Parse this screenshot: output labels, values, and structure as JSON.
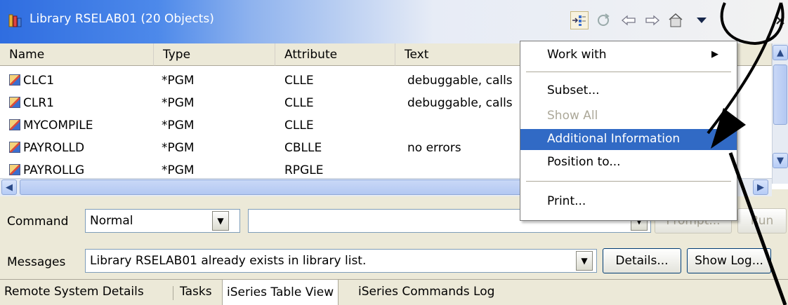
{
  "view": {
    "title": "Library RSELAB01 (20 Objects)",
    "toolbar_icons": [
      "link-with-editor-icon",
      "refresh-icon",
      "back-arrow-icon",
      "forward-arrow-icon",
      "home-icon",
      "view-menu-icon",
      "close-icon"
    ]
  },
  "table": {
    "columns": [
      "Name",
      "Type",
      "Attribute",
      "Text"
    ],
    "rows": [
      {
        "name": "CLC1",
        "type": "*PGM",
        "attribute": "CLLE",
        "text": "debuggable, calls"
      },
      {
        "name": "CLR1",
        "type": "*PGM",
        "attribute": "CLLE",
        "text": "debuggable, calls"
      },
      {
        "name": "MYCOMPILE",
        "type": "*PGM",
        "attribute": "CLLE",
        "text": ""
      },
      {
        "name": "PAYROLLD",
        "type": "*PGM",
        "attribute": "CBLLE",
        "text": "no errors"
      },
      {
        "name": "PAYROLLG",
        "type": "*PGM",
        "attribute": "RPGLE",
        "text": ""
      }
    ]
  },
  "context_menu": {
    "items": [
      "Work with",
      "Subset...",
      "Show All",
      "Additional Information",
      "Position to...",
      "Print..."
    ],
    "selected": "Additional Information",
    "disabled": [
      "Show All"
    ]
  },
  "command": {
    "label": "Command",
    "mode": "Normal",
    "input_value": "",
    "prompt_label": "Prompt...",
    "run_label": "Run"
  },
  "messages": {
    "label": "Messages",
    "value": "Library RSELAB01 already exists in library list.",
    "details_label": "Details...",
    "show_log_label": "Show Log..."
  },
  "tabs": [
    "Remote System Details",
    "Tasks",
    "iSeries Table View",
    "iSeries Commands Log"
  ],
  "active_tab": "iSeries Table View",
  "colors": {
    "title_gradient_start": "#2f6de0",
    "menu_selection": "#316ac5",
    "annotation": "#000000"
  }
}
